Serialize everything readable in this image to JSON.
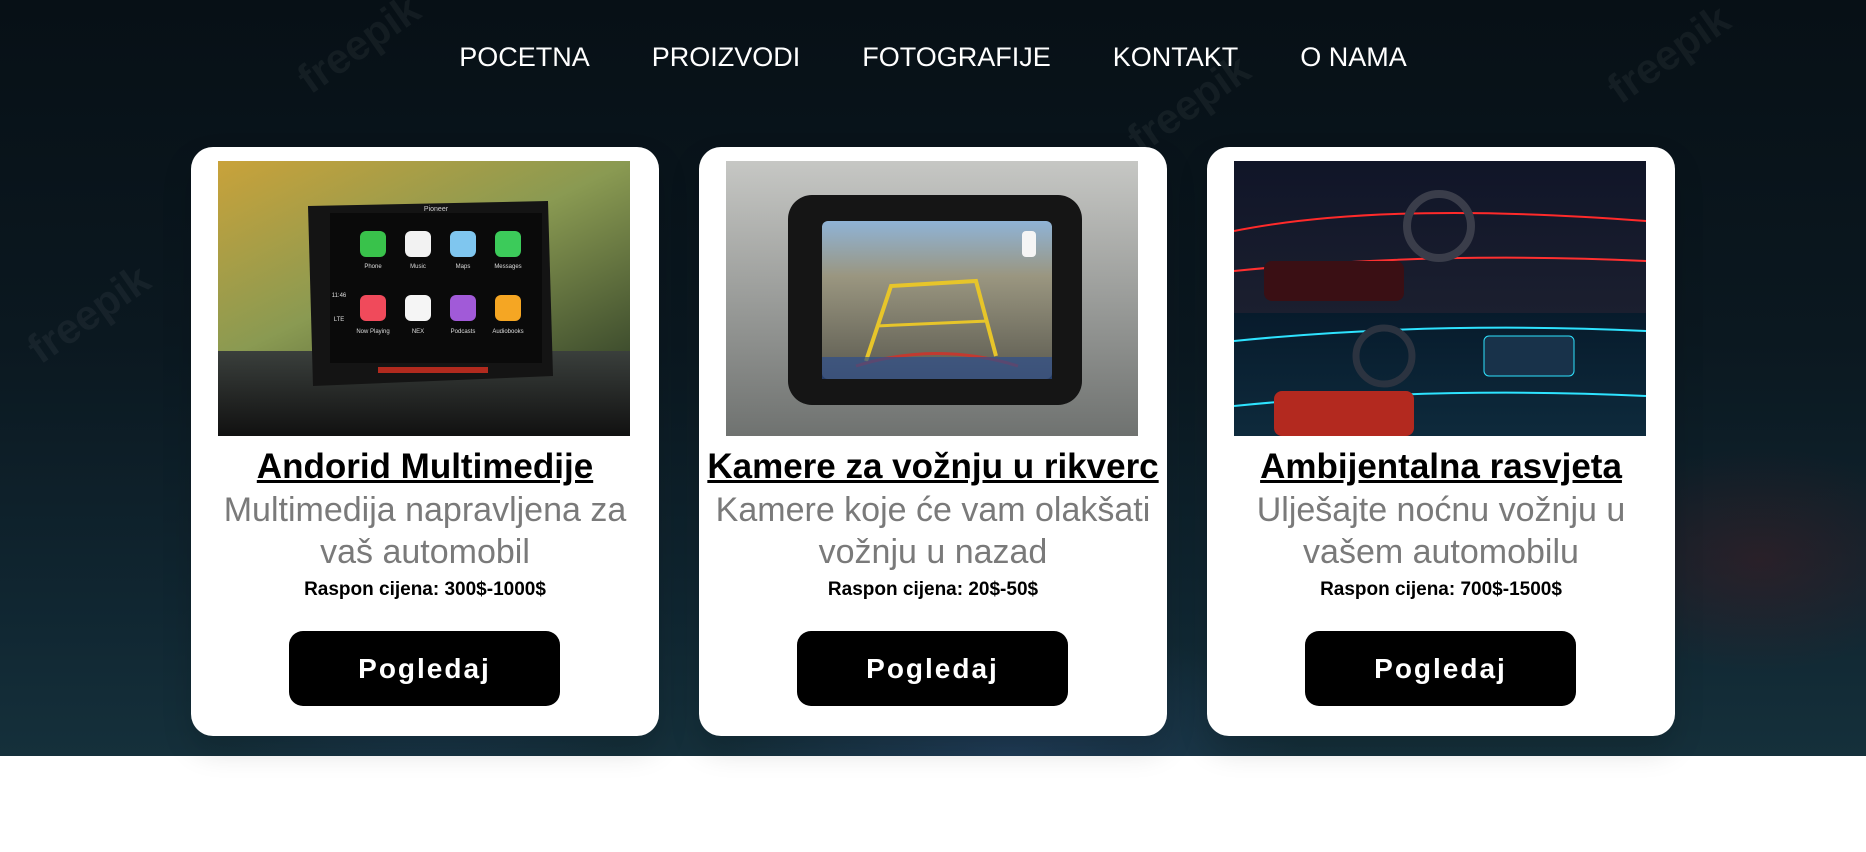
{
  "nav": {
    "items": [
      {
        "label": "POCETNA"
      },
      {
        "label": "PROIZVODI"
      },
      {
        "label": "FOTOGRAFIJE"
      },
      {
        "label": "KONTAKT"
      },
      {
        "label": "O NAMA"
      }
    ]
  },
  "watermark": "freepik",
  "products": [
    {
      "title": "Andorid Multimedije",
      "description": "Multimedija napravljena za vaš automobil",
      "price": "Raspon cijena: 300$-1000$",
      "button": "Pogledaj",
      "screen_labels": {
        "brand": "Pioneer",
        "time": "11:46",
        "signal": "LTE",
        "apps": [
          "Phone",
          "Music",
          "Maps",
          "Messages",
          "Now Playing",
          "NEX",
          "Podcasts",
          "Audiobooks"
        ]
      }
    },
    {
      "title": "Kamere za vožnju u rikverc",
      "description": "Kamere koje će vam olakšati vožnju u nazad",
      "price": "Raspon cijena: 20$-50$",
      "button": "Pogledaj"
    },
    {
      "title": "Ambijentalna rasvjeta",
      "description": "Ulješajte noćnu vožnju u vašem automobilu",
      "price": "Raspon cijena: 700$-1500$",
      "button": "Pogledaj"
    }
  ],
  "colors": {
    "hero_bg": "#0b1820",
    "card_bg": "#ffffff",
    "button_bg": "#000000",
    "description_text": "#7a7a7a"
  }
}
